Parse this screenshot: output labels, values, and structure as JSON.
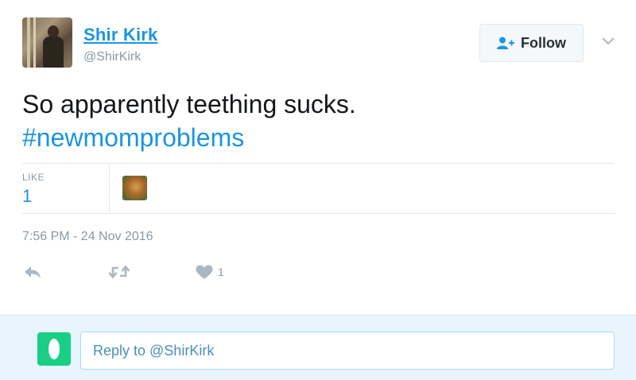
{
  "author": {
    "name": "Shir Kirk",
    "handle": "@ShirKirk"
  },
  "follow_button": {
    "label": "Follow",
    "icon": "add-user-icon"
  },
  "menu": {
    "icon": "chevron-down-icon"
  },
  "tweet": {
    "text": "So apparently teething sucks.",
    "hashtag": "#newmomproblems"
  },
  "stats": {
    "like_label": "LIKE",
    "like_count": "1"
  },
  "timestamp": "7:56 PM - 24 Nov 2016",
  "actions": {
    "reply_icon": "reply-icon",
    "retweet_icon": "retweet-icon",
    "like_icon": "heart-icon",
    "like_count": "1"
  },
  "reply": {
    "placeholder": "Reply to @ShirKirk"
  },
  "colors": {
    "link_blue": "#1b95e0",
    "muted_gray": "#8899a6",
    "reply_bg": "#e8f5fd",
    "egg_green": "#19cf86"
  }
}
